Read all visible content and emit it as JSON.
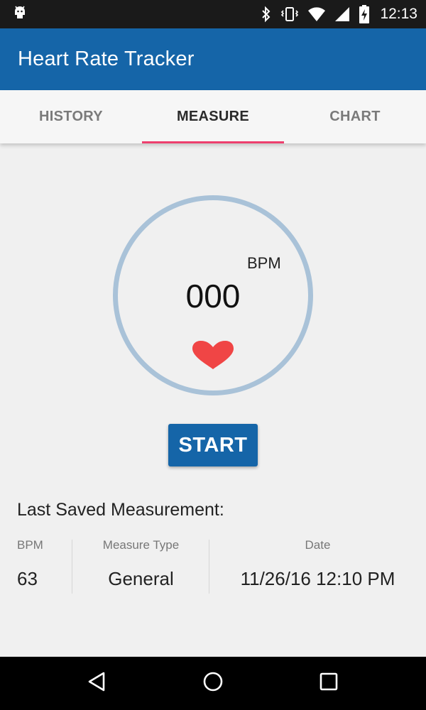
{
  "status_bar": {
    "time": "12:13",
    "icons": [
      "android-debug-icon",
      "bluetooth-icon",
      "vibrate-icon",
      "wifi-icon",
      "signal-icon",
      "battery-charging-icon"
    ]
  },
  "app_bar": {
    "title": "Heart Rate Tracker",
    "color": "#1565a8"
  },
  "tabs": [
    {
      "label": "HISTORY",
      "active": false
    },
    {
      "label": "MEASURE",
      "active": true
    },
    {
      "label": "CHART",
      "active": false
    }
  ],
  "accent_color": "#ee3f6e",
  "measure": {
    "unit": "BPM",
    "value": "000",
    "icon": "heart-icon",
    "start_label": "START"
  },
  "last_saved": {
    "title": "Last Saved Measurement:",
    "columns": [
      {
        "header": "BPM",
        "value": "63"
      },
      {
        "header": "Measure Type",
        "value": "General"
      },
      {
        "header": "Date",
        "value": "11/26/16 12:10 PM"
      }
    ]
  },
  "nav_bar": {
    "buttons": [
      "back-icon",
      "home-icon",
      "recents-icon"
    ]
  }
}
